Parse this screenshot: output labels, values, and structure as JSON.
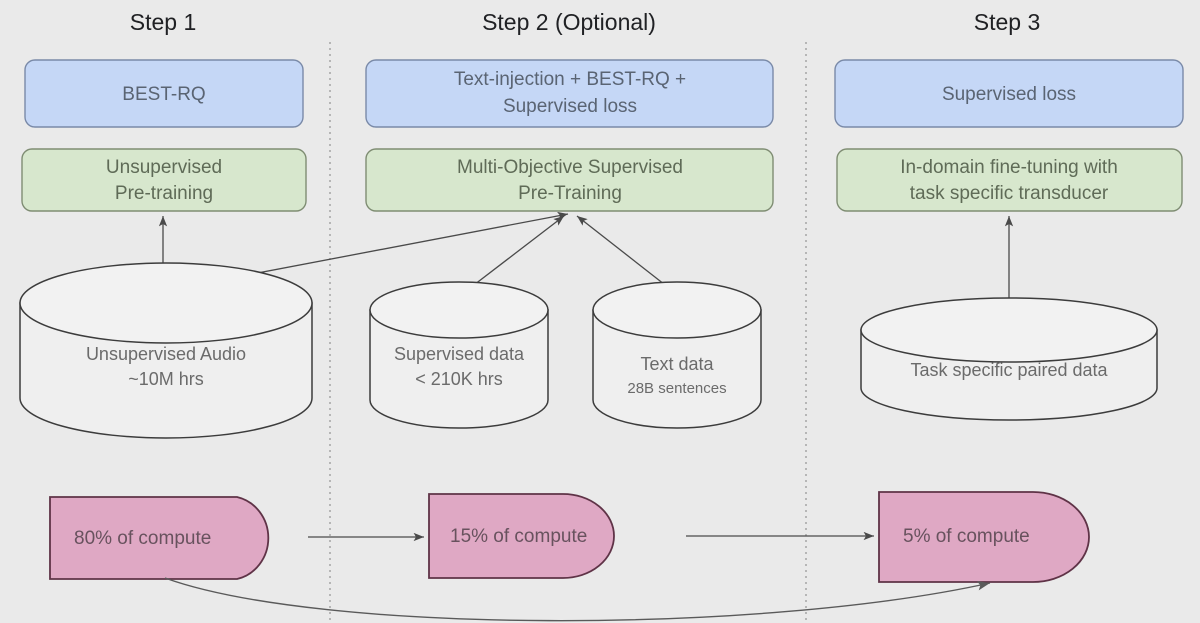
{
  "diagram": {
    "background_color": "#eaeaea",
    "columns": [
      {
        "id": "step1",
        "title": "Step 1"
      },
      {
        "id": "step2",
        "title": "Step 2 (Optional)"
      },
      {
        "id": "step3",
        "title": "Step 3"
      }
    ],
    "objective_boxes": [
      {
        "id": "obj1",
        "line1": "BEST-RQ",
        "line2": "",
        "color": "#c5d7f6"
      },
      {
        "id": "obj2",
        "line1": "Text-injection + BEST-RQ +",
        "line2": "Supervised loss",
        "color": "#c5d7f6"
      },
      {
        "id": "obj3",
        "line1": "Supervised loss",
        "line2": "",
        "color": "#c5d7f6"
      }
    ],
    "stage_boxes": [
      {
        "id": "stg1",
        "line1": "Unsupervised",
        "line2": "Pre-training",
        "color": "#d7e7cd"
      },
      {
        "id": "stg2",
        "line1": "Multi-Objective Supervised",
        "line2": "Pre-Training",
        "color": "#d7e7cd"
      },
      {
        "id": "stg3",
        "line1": "In-domain fine-tuning with",
        "line2": "task specific transducer",
        "color": "#d7e7cd"
      }
    ],
    "data_stores": [
      {
        "id": "ds1",
        "line1": "Unsupervised Audio",
        "line2": "~10M hrs",
        "small_second_line": false
      },
      {
        "id": "ds2",
        "line1": "Supervised data",
        "line2": "< 210K hrs",
        "small_second_line": false
      },
      {
        "id": "ds3",
        "line1": "Text data",
        "line2": "28B sentences",
        "small_second_line": true
      },
      {
        "id": "ds4",
        "line1": "Task specific paired data",
        "line2": "",
        "small_second_line": false
      }
    ],
    "compute_shapes": [
      {
        "id": "cmp1",
        "label": "80% of compute",
        "color": "#dfa8c4"
      },
      {
        "id": "cmp2",
        "label": "15% of compute",
        "color": "#dfa8c4"
      },
      {
        "id": "cmp3",
        "label": "5% of compute",
        "color": "#dfa8c4"
      }
    ]
  }
}
